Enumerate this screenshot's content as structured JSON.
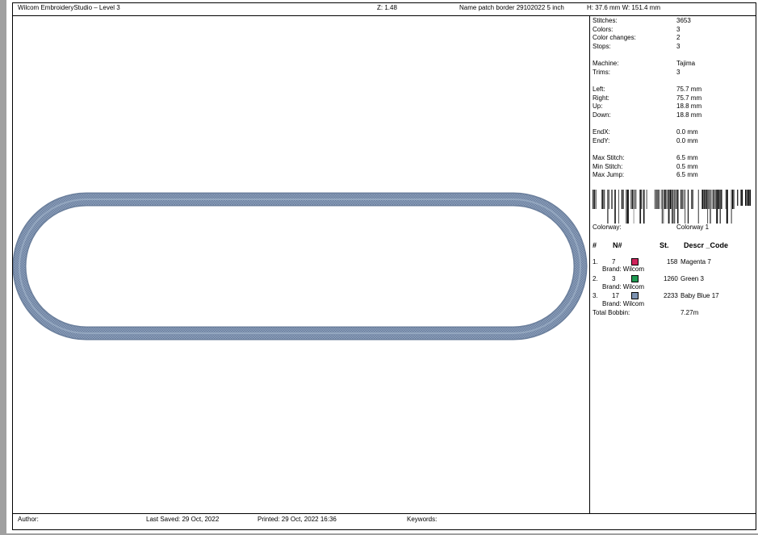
{
  "header": {
    "app_title": "Wilcom EmbroideryStudio – Level 3",
    "zoom": "Z: 1.48",
    "design_name": "Name patch border 29102022 5 inch",
    "dimensions": "H: 37.6 mm   W: 151.4 mm"
  },
  "stats": {
    "stitches": {
      "label": "Stitches:",
      "value": "3653"
    },
    "colors": {
      "label": "Colors:",
      "value": "3"
    },
    "color_changes": {
      "label": "Color changes:",
      "value": "2"
    },
    "stops": {
      "label": "Stops:",
      "value": "3"
    },
    "machine": {
      "label": "Machine:",
      "value": "Tajima"
    },
    "trims": {
      "label": "Trims:",
      "value": "3"
    },
    "left": {
      "label": "Left:",
      "value": "75.7 mm"
    },
    "right": {
      "label": "Right:",
      "value": "75.7 mm"
    },
    "up": {
      "label": "Up:",
      "value": "18.8 mm"
    },
    "down": {
      "label": "Down:",
      "value": "18.8 mm"
    },
    "endx": {
      "label": "EndX:",
      "value": "0.0 mm"
    },
    "endy": {
      "label": "EndY:",
      "value": "0.0 mm"
    },
    "max_stitch": {
      "label": "Max Stitch:",
      "value": "6.5 mm"
    },
    "min_stitch": {
      "label": "Min Stitch:",
      "value": "0.5 mm"
    },
    "max_jump": {
      "label": "Max Jump:",
      "value": "6.5 mm"
    }
  },
  "colorway": {
    "label": "Colorway:",
    "value": "Colorway 1"
  },
  "thread_table": {
    "headers": {
      "index": "#",
      "number": "N#",
      "stitches": "St.",
      "descr": "Descr _Code"
    },
    "rows": [
      {
        "index": "1.",
        "number": "7",
        "color": "#d0245c",
        "stitches": "158",
        "descr": "Magenta 7",
        "brand": "Brand: Wilcom"
      },
      {
        "index": "2.",
        "number": "3",
        "color": "#1f9a52",
        "stitches": "1260",
        "descr": "Green 3",
        "brand": "Brand: Wilcom"
      },
      {
        "index": "3.",
        "number": "17",
        "color": "#7d93b2",
        "stitches": "2233",
        "descr": "Baby Blue 17",
        "brand": "Brand: Wilcom"
      }
    ],
    "total_bobbin": {
      "label": "Total Bobbin:",
      "value": "7.27m"
    }
  },
  "design": {
    "border_color": "#7e93b1",
    "shape": "rounded-rectangle-border"
  },
  "footer": {
    "author": "Author:",
    "last_saved": "Last Saved: 29 Oct, 2022",
    "printed": "Printed: 29 Oct, 2022 16:36",
    "keywords": "Keywords:"
  }
}
